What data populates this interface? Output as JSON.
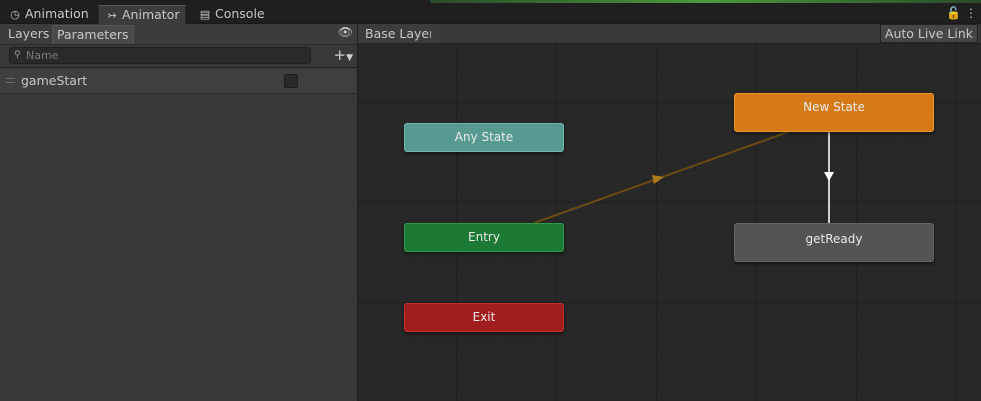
{
  "tabs": [
    {
      "label": "Animation",
      "icon": "clock-icon"
    },
    {
      "label": "Animator",
      "icon": "animator-icon"
    },
    {
      "label": "Console",
      "icon": "console-icon"
    }
  ],
  "left_panel": {
    "subtabs": [
      "Layers",
      "Parameters"
    ],
    "active_subtab": "Parameters",
    "search_placeholder": "Name",
    "parameters": [
      {
        "name": "gameStart",
        "type": "bool",
        "value": false
      }
    ]
  },
  "graph": {
    "breadcrumb": "Base Layer",
    "auto_live_link": "Auto Live Link",
    "nodes": {
      "any_state": "Any State",
      "entry": "Entry",
      "exit": "Exit",
      "new_state": "New State",
      "get_ready": "getReady"
    }
  },
  "colors": {
    "any_state": "#579a91",
    "entry": "#1d7a35",
    "exit": "#a21d1d",
    "default_state": "#d57a16",
    "state": "#545454",
    "transition_default": "#6b4a12",
    "transition": "#d0d0d0"
  }
}
